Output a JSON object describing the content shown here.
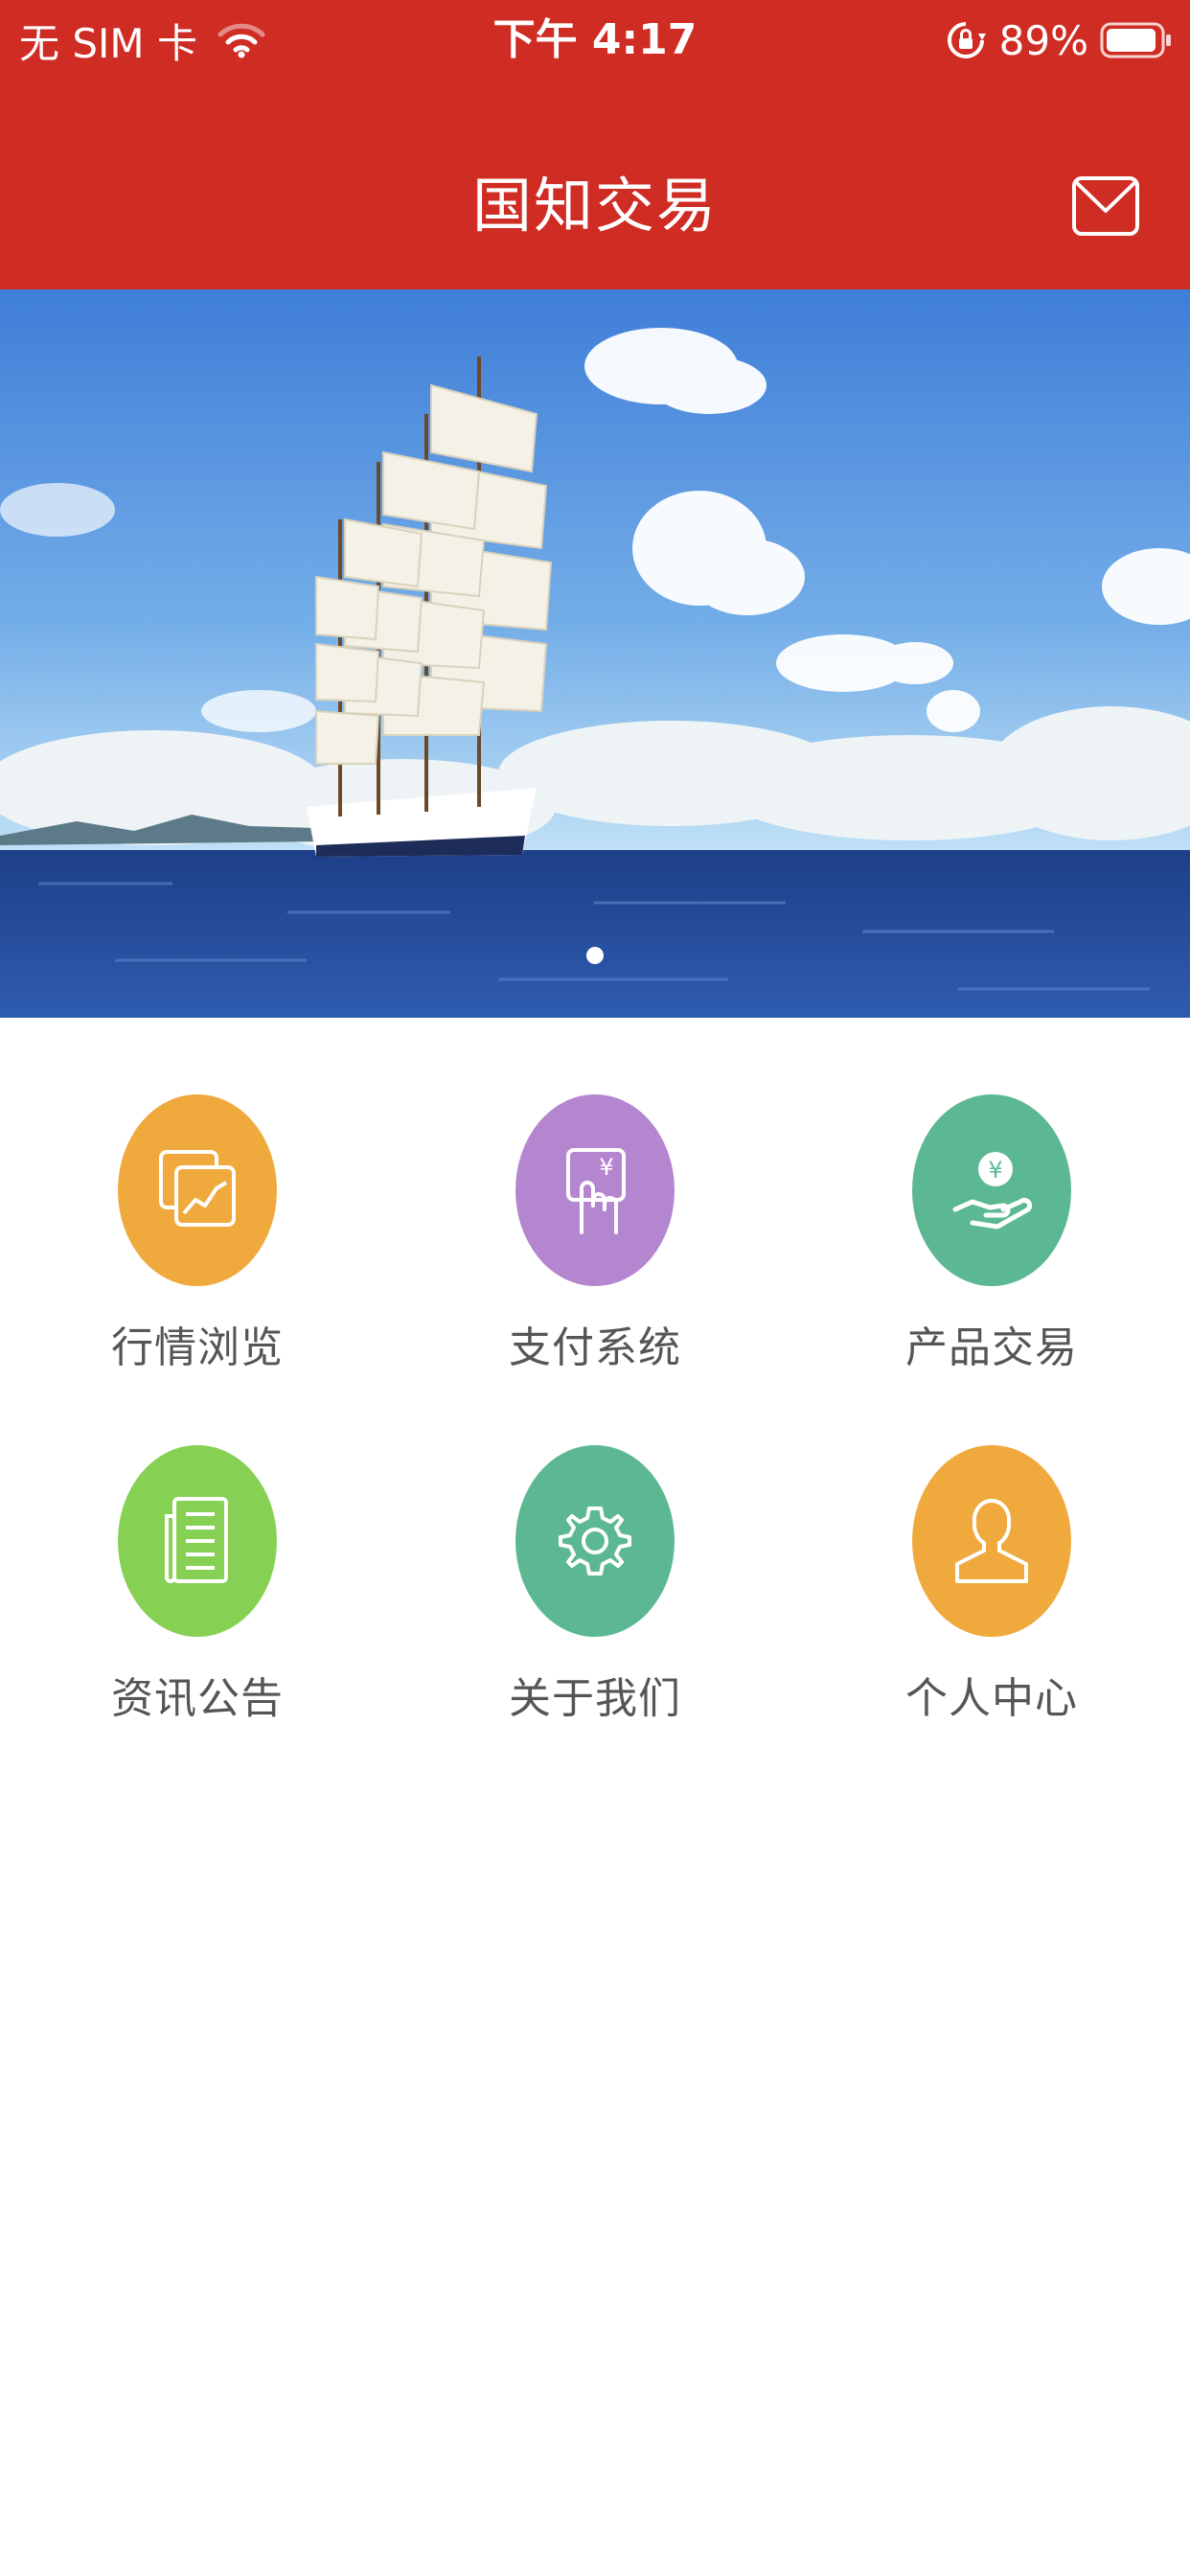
{
  "status_bar": {
    "carrier": "无 SIM 卡",
    "time": "下午 4:17",
    "battery": "89%"
  },
  "header": {
    "title": "国知交易",
    "mail_icon": "mail-icon",
    "background_color": "#cf2c24"
  },
  "banner": {
    "image": "sailing-ship-at-sea",
    "page_indicator": {
      "current": 1,
      "total": 1
    }
  },
  "menu": {
    "items": [
      {
        "label": "行情浏览",
        "icon": "chart-icon",
        "color": "#f0a93c"
      },
      {
        "label": "支付系统",
        "icon": "payment-icon",
        "color": "#b586d0"
      },
      {
        "label": "产品交易",
        "icon": "hand-money-icon",
        "color": "#5cb892"
      },
      {
        "label": "资讯公告",
        "icon": "newspaper-icon",
        "color": "#86d053"
      },
      {
        "label": "关于我们",
        "icon": "gear-icon",
        "color": "#5cb892"
      },
      {
        "label": "个人中心",
        "icon": "person-icon",
        "color": "#f0a93c"
      }
    ]
  }
}
